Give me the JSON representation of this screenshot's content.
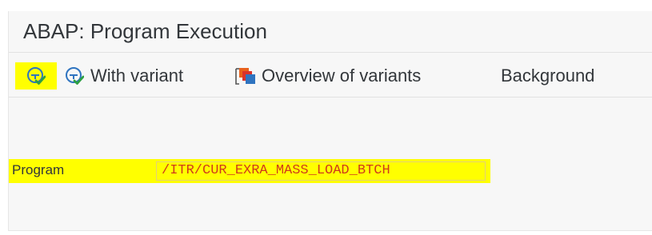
{
  "window": {
    "title": "ABAP: Program Execution"
  },
  "toolbar": {
    "execute": {
      "icon": "execute-icon",
      "highlight_color": "#ffff00"
    },
    "with_variant": {
      "icon": "execute-with-variant-icon",
      "label": "With variant"
    },
    "overview_of_variants": {
      "icon": "variants-overview-icon",
      "label": "Overview of variants"
    },
    "background": {
      "label": "Background"
    }
  },
  "form": {
    "program": {
      "label": "Program",
      "value": "/ITR/CUR_EXRA_MASS_LOAD_BTCH",
      "highlight_color": "#ffff00",
      "value_color": "#d03a1b"
    }
  },
  "colors": {
    "icon_blue": "#2f74c0",
    "icon_green": "#2ea043",
    "icon_orange": "#e8611c",
    "icon_red": "#d9342b",
    "text": "#32363a"
  }
}
